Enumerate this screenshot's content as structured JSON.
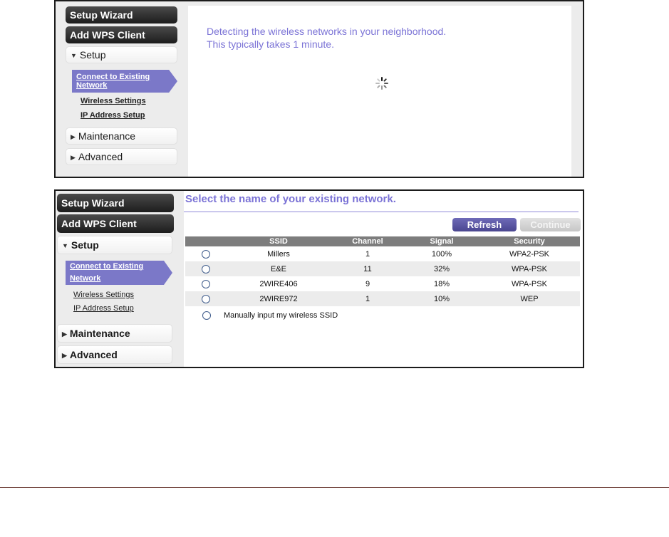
{
  "panel1": {
    "sidebar": {
      "setup_wizard": "Setup Wizard",
      "add_wps": "Add WPS Client",
      "setup": "Setup",
      "connect_existing": "Connect to Existing Network",
      "wireless_settings": "Wireless Settings",
      "ip_address_setup": "IP Address Setup",
      "maintenance": "Maintenance",
      "advanced": "Advanced"
    },
    "detecting_line1": "Detecting the wireless networks in your neighborhood.",
    "detecting_line2": "This typically takes 1 minute."
  },
  "panel2": {
    "sidebar": {
      "setup_wizard": "Setup Wizard",
      "add_wps": "Add WPS Client",
      "setup": "Setup",
      "connect_existing": "Connect to Existing Network",
      "wireless_settings": "Wireless Settings",
      "ip_address_setup": "IP Address Setup",
      "maintenance": "Maintenance",
      "advanced": "Advanced"
    },
    "title": "Select the name of your existing network.",
    "refresh_label": "Refresh",
    "continue_label": "Continue",
    "columns": [
      "",
      "SSID",
      "Channel",
      "Signal",
      "Security"
    ],
    "networks": [
      {
        "ssid": "Millers",
        "channel": "1",
        "signal": "100%",
        "security": "WPA2-PSK"
      },
      {
        "ssid": "E&E",
        "channel": "11",
        "signal": "32%",
        "security": "WPA-PSK"
      },
      {
        "ssid": "2WIRE406",
        "channel": "9",
        "signal": "18%",
        "security": "WPA-PSK"
      },
      {
        "ssid": "2WIRE972",
        "channel": "1",
        "signal": "10%",
        "security": "WEP"
      }
    ],
    "manual_label": "Manually input my wireless SSID"
  },
  "colors": {
    "accent": "#7b73d6",
    "active_menu": "#7b78c8",
    "refresh_button": "#5a56a6",
    "table_header": "#7d7d7d"
  }
}
